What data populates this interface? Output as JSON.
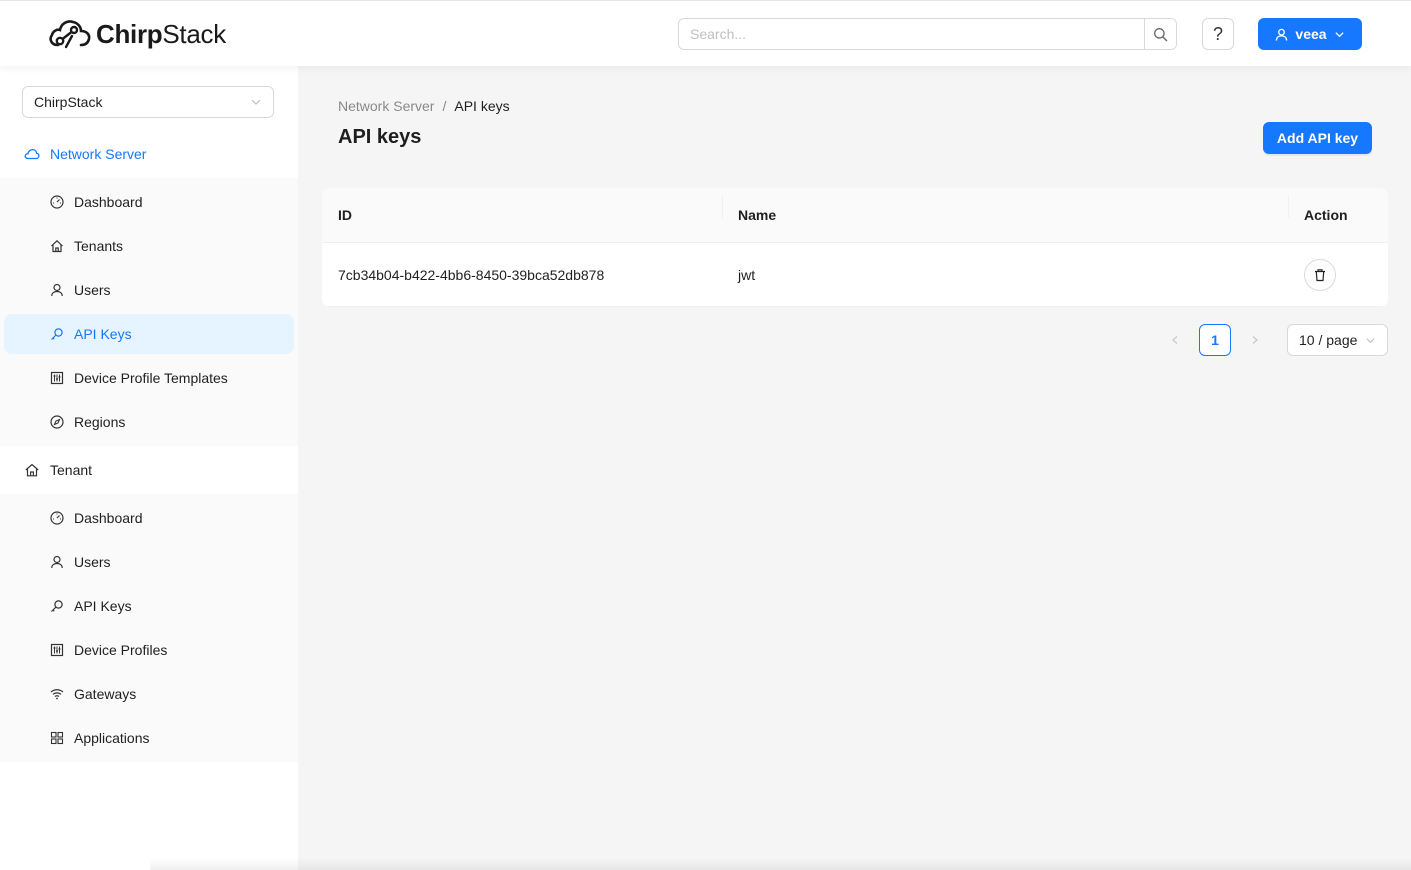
{
  "header": {
    "logo_text_bold": "Chirp",
    "logo_text_rest": "Stack",
    "search_placeholder": "Search...",
    "help_label": "?",
    "user_label": "veea"
  },
  "sidebar": {
    "tenant_select_value": "ChirpStack",
    "network_server": {
      "title": "Network Server",
      "items": [
        {
          "label": "Dashboard",
          "icon": "dashboard-icon"
        },
        {
          "label": "Tenants",
          "icon": "home-icon"
        },
        {
          "label": "Users",
          "icon": "user-icon"
        },
        {
          "label": "API Keys",
          "icon": "key-icon",
          "selected": true
        },
        {
          "label": "Device Profile Templates",
          "icon": "control-icon"
        },
        {
          "label": "Regions",
          "icon": "compass-icon"
        }
      ]
    },
    "tenant": {
      "title": "Tenant",
      "items": [
        {
          "label": "Dashboard",
          "icon": "dashboard-icon"
        },
        {
          "label": "Users",
          "icon": "user-icon"
        },
        {
          "label": "API Keys",
          "icon": "key-icon"
        },
        {
          "label": "Device Profiles",
          "icon": "control-icon"
        },
        {
          "label": "Gateways",
          "icon": "wifi-icon"
        },
        {
          "label": "Applications",
          "icon": "appstore-icon"
        }
      ]
    }
  },
  "main": {
    "breadcrumb": [
      "Network Server",
      "API keys"
    ],
    "breadcrumb_separator": "/",
    "title": "API keys",
    "add_button_label": "Add API key",
    "table": {
      "columns": [
        "ID",
        "Name",
        "Action"
      ],
      "rows": [
        {
          "id": "7cb34b04-b422-4bb6-8450-39bca52db878",
          "name": "jwt"
        }
      ]
    },
    "pagination": {
      "current_page": "1",
      "page_size_label": "10 / page"
    }
  },
  "colors": {
    "primary": "#1677ff",
    "selected_bg": "#e6f4ff",
    "content_bg": "#f5f5f5"
  }
}
